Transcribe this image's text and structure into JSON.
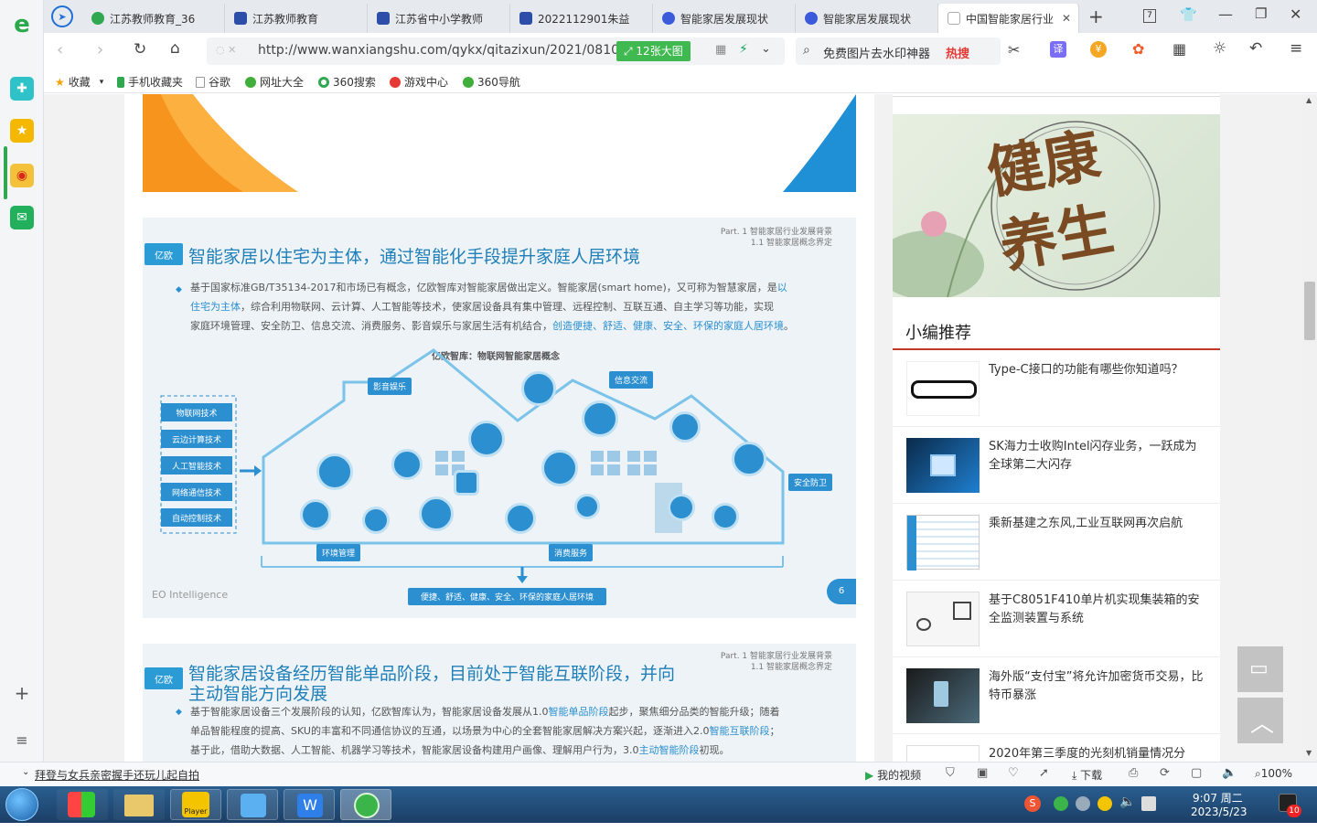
{
  "tabs": [
    {
      "label": "江苏教师教育_36",
      "color": "#2fa84f"
    },
    {
      "label": "江苏教师教育",
      "color": "#2c4da8"
    },
    {
      "label": "江苏省中小学教师",
      "color": "#2c4da8"
    },
    {
      "label": "2022112901朱益",
      "color": "#2c4da8"
    },
    {
      "label": "智能家居发展现状",
      "color": "#3b5bdb"
    },
    {
      "label": "智能家居发展现状",
      "color": "#3b5bdb"
    },
    {
      "label": "中国智能家居行业",
      "color": "#aaaaaa"
    }
  ],
  "tab_count": "7",
  "address": {
    "url": "http://www.wanxiangshu.com/qykx/qitazixun/2021/0810/",
    "badge": "12张大图",
    "search_placeholder": "免费图片去水印神器",
    "hot": "热搜"
  },
  "bookmarks": [
    "收藏",
    "手机收藏夹",
    "谷歌",
    "网址大全",
    "360搜索",
    "游戏中心",
    "360导航"
  ],
  "slide1": {
    "part": "Part. 1 智能家居行业发展背景",
    "sub": "1.1 智能家居概念界定",
    "logo": "亿欧",
    "title": "智能家居以住宅为主体，通过智能化手段提升家庭人居环境",
    "p1": "基于国家标准GB/T35134-2017和市场已有概念，亿欧智库对智能家居做出定义。智能家居(smart home)，又可称为智慧家居，是",
    "p1_hl": "以",
    "p2_hl": "住宅为主体",
    "p2": "，综合利用物联网、云计算、人工智能等技术，使家居设备具有集中管理、远程控制、互联互通、自主学习等功能，实现",
    "p3": "家庭环境管理、安全防卫、信息交流、消费服务、影音娱乐与家居生活有机结合，",
    "p3_hl": "创造便捷、舒适、健康、安全、环保的家庭人居环境",
    "p3_end": "。",
    "diagram_title": "亿欧智库：物联网智能家居概念",
    "techs": [
      "物联网技术",
      "云边计算技术",
      "人工智能技术",
      "网络通信技术",
      "自动控制技术"
    ],
    "labels": {
      "av": "影音娱乐",
      "info": "信息交流",
      "security": "安全防卫",
      "env": "环境管理",
      "consume": "消费服务"
    },
    "bottom": "便捷、舒适、健康、安全、环保的家庭人居环境",
    "footer": "EO Intelligence",
    "page": "6"
  },
  "slide2": {
    "part": "Part. 1 智能家居行业发展背景",
    "sub": "1.1 智能家居概念界定",
    "logo": "亿欧",
    "title1": "智能家居设备经历智能单品阶段，目前处于智能互联阶段，并向",
    "title2": "主动智能方向发展",
    "l1a": "基于智能家居设备三个发展阶段的认知，亿欧智库认为，智能家居设备发展从1.0",
    "l1hl": "智能单品阶段",
    "l1b": "起步，聚焦细分品类的智能升级；随着",
    "l2a": "单品智能程度的提高、SKU的丰富和不同通信协议的互通，以场景为中心的全套智能家居解决方案兴起，逐渐进入2.0",
    "l2hl": "智能互联阶段",
    "l2b": "；",
    "l3a": "基于此，借助大数据、人工智能、机器学习等技术，智能家居设备构建用户画像、理解用户行为，3.0",
    "l3hl": "主动智能阶段",
    "l3b": "初现。"
  },
  "sidebar": {
    "banner_text": "健康养生",
    "section": "小编推荐",
    "items": [
      "Type-C接口的功能有哪些你知道吗？",
      "SK海力士收购Intel闪存业务，一跃成为全球第二大闪存",
      "乘新基建之东风,工业互联网再次启航",
      "基于C8051F410单片机实现集装箱的安全监测装置与系统",
      "海外版“支付宝”将允许加密货币交易，比特币暴涨",
      "2020年第三季度的光刻机销量情况分"
    ]
  },
  "status": {
    "news": "拜登与女兵亲密握手还玩儿起自拍",
    "video": "我的视频",
    "download": "下载",
    "zoom": "100%"
  },
  "taskbar": {
    "time": "9:07 周二",
    "date": "2023/5/23",
    "badge": "10",
    "player": "Player"
  }
}
